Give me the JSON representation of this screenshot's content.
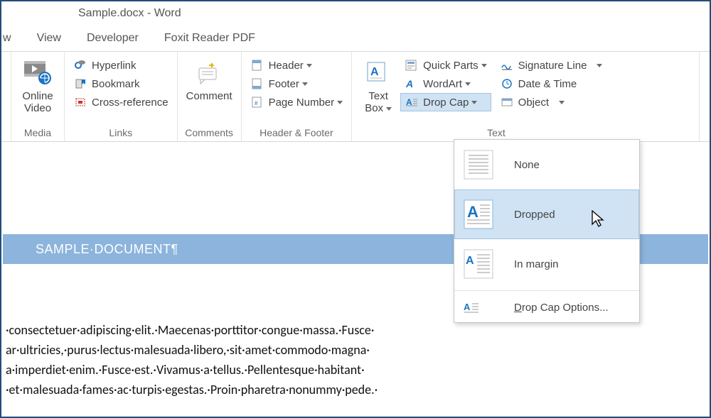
{
  "window_title": "Sample.docx - Word",
  "tabs": {
    "left_cut": "w",
    "view": "View",
    "developer": "Developer",
    "foxit": "Foxit Reader PDF"
  },
  "ribbon": {
    "media": {
      "label": "Media",
      "online_video": "Online\nVideo"
    },
    "links": {
      "label": "Links",
      "hyperlink": "Hyperlink",
      "bookmark": "Bookmark",
      "crossref": "Cross-reference"
    },
    "comments": {
      "label": "Comments",
      "comment": "Comment"
    },
    "hf": {
      "label": "Header & Footer",
      "header": "Header",
      "footer": "Footer",
      "pagenum": "Page Number"
    },
    "text": {
      "label": "Text",
      "textbox": "Text\nBox",
      "quick_parts": "Quick Parts",
      "wordart": "WordArt",
      "dropcap": "Drop Cap",
      "sig_line": "Signature Line",
      "date_time": "Date & Time",
      "object": "Object"
    }
  },
  "dropcap_menu": {
    "none": "None",
    "dropped": "Dropped",
    "in_margin": "In margin",
    "options_prefix": "D",
    "options_rest": "rop Cap Options..."
  },
  "doc_heading": "SAMPLE·DOCUMENT¶",
  "body_lines": [
    "·consectetuer·adipiscing·elit.·Maecenas·porttitor·congue·massa.·Fusce·",
    "ar·ultricies,·purus·lectus·malesuada·libero,·sit·amet·commodo·magna·",
    "a·imperdiet·enim.·Fusce·est.·Vivamus·a·tellus.·Pellentesque·habitant·",
    "·et·malesuada·fames·ac·turpis·egestas.·Proin·pharetra·nonummy·pede.·"
  ]
}
